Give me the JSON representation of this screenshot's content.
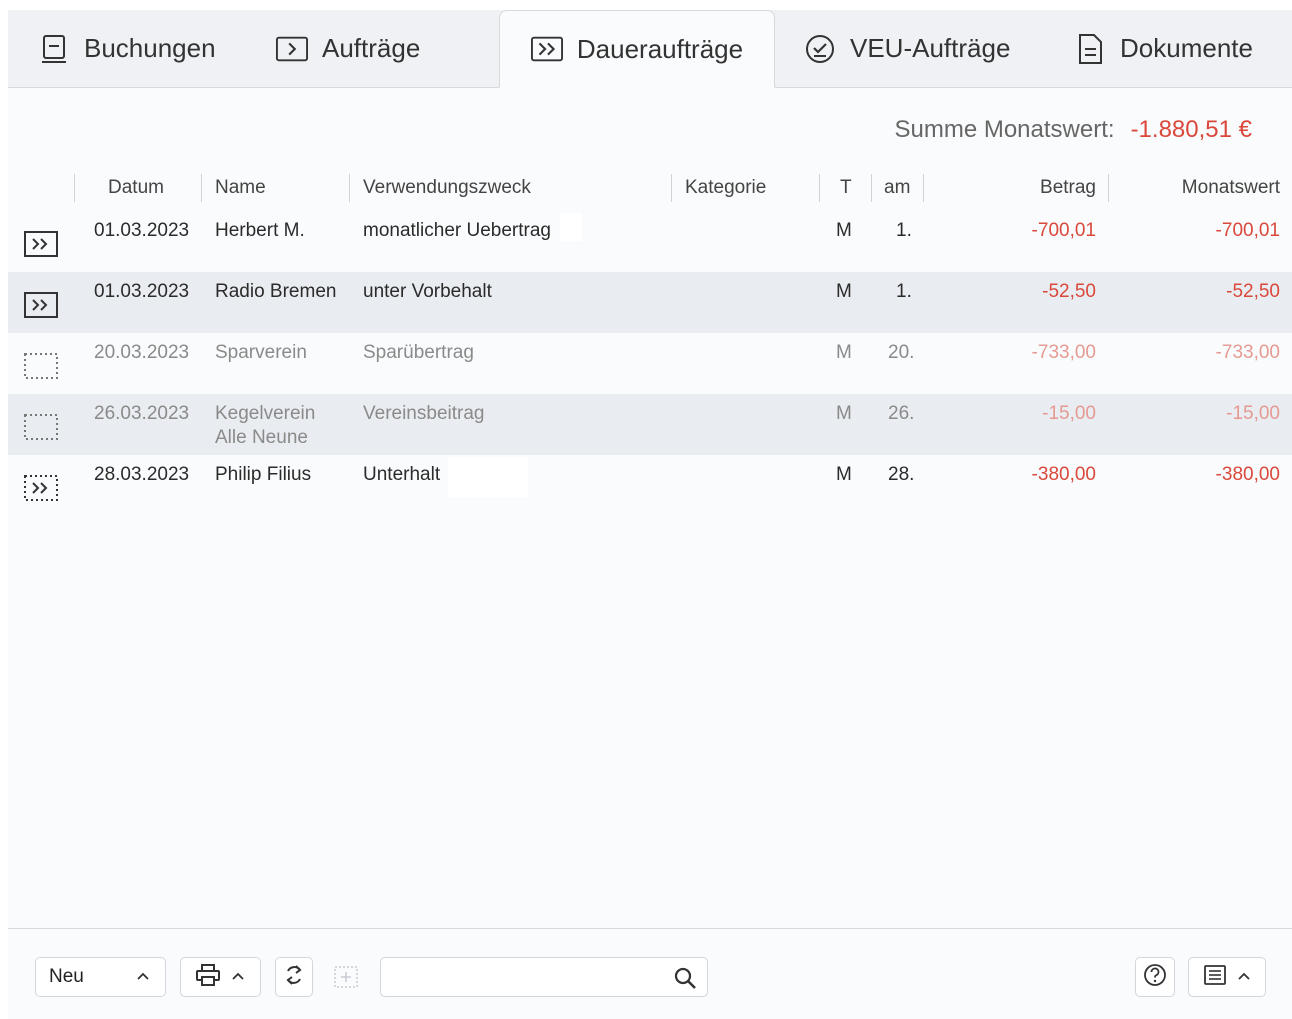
{
  "tabs": [
    {
      "label": "Buchungen",
      "icon": "book-icon",
      "active": false
    },
    {
      "label": "Aufträge",
      "icon": "single-arrow-icon",
      "active": false
    },
    {
      "label": "Daueraufträge",
      "icon": "double-arrow-icon",
      "active": true
    },
    {
      "label": "VEU-Aufträge",
      "icon": "check-circle-icon",
      "active": false
    },
    {
      "label": "Dokumente",
      "icon": "document-icon",
      "active": false
    }
  ],
  "summary": {
    "label": "Summe Monatswert:",
    "value": "-1.880,51 €"
  },
  "columns": {
    "datum": "Datum",
    "name": "Name",
    "verwendungszweck": "Verwendungszweck",
    "kategorie": "Kategorie",
    "t": "T",
    "am": "am",
    "betrag": "Betrag",
    "monatswert": "Monatswert"
  },
  "rows": [
    {
      "icon": "standing-order-active-icon",
      "datum": "01.03.2023",
      "name": "Herbert M.",
      "name2": "",
      "zweck": "monatlicher Uebertrag",
      "kategorie": "",
      "t": "M",
      "am": "1.",
      "betrag": "-700,01",
      "monatswert": "-700,01"
    },
    {
      "icon": "standing-order-active-icon",
      "datum": "01.03.2023",
      "name": "Radio Bremen",
      "name2": "",
      "zweck": "unter Vorbehalt",
      "kategorie": "",
      "t": "M",
      "am": "1.",
      "betrag": "-52,50",
      "monatswert": "-52,50"
    },
    {
      "icon": "standing-order-inactive-icon",
      "datum": "20.03.2023",
      "name": "Sparverein",
      "name2": "",
      "zweck": "Sparübertrag",
      "kategorie": "",
      "t": "M",
      "am": "20.",
      "betrag": "-733,00",
      "monatswert": "-733,00"
    },
    {
      "icon": "standing-order-inactive-icon",
      "datum": "26.03.2023",
      "name": "Kegelverein",
      "name2": "Alle Neune",
      "zweck": "Vereinsbeitrag",
      "kategorie": "",
      "t": "M",
      "am": "26.",
      "betrag": "-15,00",
      "monatswert": "-15,00"
    },
    {
      "icon": "standing-order-pending-icon",
      "datum": "28.03.2023",
      "name": "Philip Filius",
      "name2": "",
      "zweck": "Unterhalt",
      "kategorie": "",
      "t": "M",
      "am": "28.",
      "betrag": "-380,00",
      "monatswert": "-380,00"
    }
  ],
  "footer": {
    "new_label": "Neu",
    "search_value": "",
    "search_placeholder": ""
  },
  "colors": {
    "accent_negative": "#d9483b",
    "row_alt": "#e9ecf0",
    "tabbar": "#eff1f4"
  }
}
